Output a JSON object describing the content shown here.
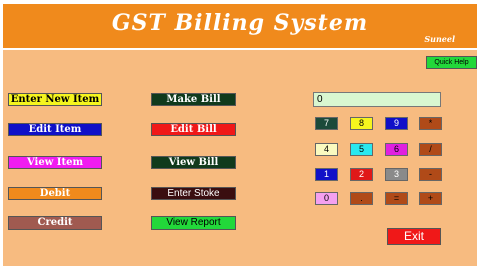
{
  "header": {
    "title": "GST Billing System",
    "author": "Suneel"
  },
  "quick_help_label": "Quick Help",
  "left_buttons": {
    "enter_new_item": "Enter New Item",
    "edit_item": "Edit Item",
    "view_item": "View Item",
    "debit": "Debit",
    "credit": "Credit"
  },
  "middle_buttons": {
    "make_bill": "Make Bill",
    "edit_bill": "Edit Bill",
    "view_bill": "View Bill",
    "enter_stoke": "Enter Stoke",
    "view_report": "View Report"
  },
  "calculator": {
    "display_value": "0",
    "keys": {
      "k7": "7",
      "k8": "8",
      "k9": "9",
      "mul": "*",
      "k4": "4",
      "k5": "5",
      "k6": "6",
      "div": "/",
      "k1": "1",
      "k2": "2",
      "k3": "3",
      "sub": "-",
      "k0": "0",
      "dot": ".",
      "eq": "=",
      "add": "+"
    }
  },
  "exit_label": "Exit",
  "colors": {
    "title_bar": "#f08a1c",
    "panel": "#f7bb80"
  }
}
